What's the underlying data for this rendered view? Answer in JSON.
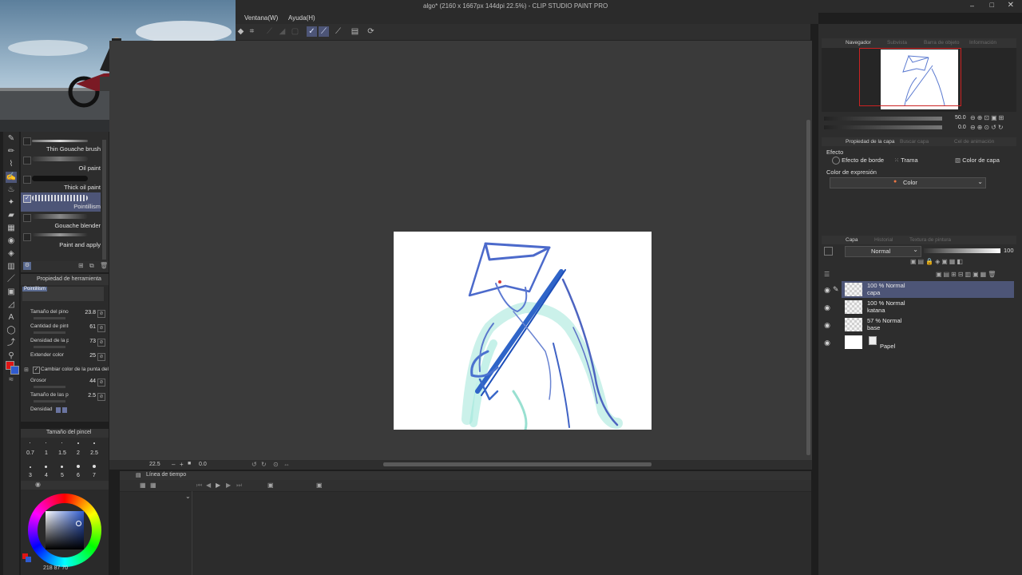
{
  "window": {
    "title": "algo* (2160 x 1667px 144dpi 22.5%) - CLIP STUDIO PAINT PRO"
  },
  "menu": {
    "items": [
      "Ventana(W)",
      "Ayuda(H)"
    ]
  },
  "subtool": {
    "brushes": [
      {
        "name": "Thin Gouache brush",
        "selected": false
      },
      {
        "name": "Oil paint",
        "selected": false
      },
      {
        "name": "Thick oil paint",
        "selected": false
      },
      {
        "name": "Pointillism",
        "selected": true
      },
      {
        "name": "Gouache blender",
        "selected": false
      },
      {
        "name": "Paint and apply",
        "selected": false
      }
    ]
  },
  "tool_property": {
    "title": "Propiedad de herramienta",
    "tool_name": "Pointillism",
    "rows": [
      {
        "label": "Tamaño del pincel",
        "value": "23.8"
      },
      {
        "label": "Cantidad de pintura",
        "value": "61"
      },
      {
        "label": "Densidad de la pintura",
        "value": "73"
      },
      {
        "label": "Extender color",
        "value": "25"
      },
      {
        "label": "Cambiar color de la punta del pincel",
        "value": ""
      },
      {
        "label": "Grosor",
        "value": "44"
      },
      {
        "label": "Tamaño de las partículas",
        "value": "2.5"
      },
      {
        "label": "Densidad",
        "value": ""
      }
    ]
  },
  "brush_size": {
    "title": "Tamaño del pincel",
    "row1": [
      "0.7",
      "1",
      "1.5",
      "2",
      "2.5"
    ],
    "row2": [
      "3",
      "4",
      "5",
      "6",
      "7"
    ]
  },
  "color": {
    "main": "#e01515",
    "sub": "#2f5bd0",
    "readout": "218  87  70"
  },
  "canvas": {
    "zoom": "22.5",
    "rotation": "0.0"
  },
  "timeline": {
    "title": "Línea de tiempo"
  },
  "navigator": {
    "tabs": [
      "Navegador",
      "Subvista",
      "Barra de objeto",
      "Información"
    ],
    "zoom": "50.0",
    "rotation": "0.0"
  },
  "layer_property": {
    "tabs": [
      "Propiedad de la capa",
      "Buscar capa",
      "Cel de animación"
    ],
    "effect_label": "Efecto",
    "effect_buttons": [
      "Efecto de borde",
      "Trama",
      "Color de capa"
    ],
    "expression_label": "Color de expresión",
    "expression_value": "Color"
  },
  "layers_panel": {
    "tabs": [
      "Capa",
      "Historial",
      "Textura de pintura"
    ],
    "blend_mode": "Normal",
    "opacity": "100",
    "layers": [
      {
        "line1": "100 % Normal",
        "line2": "capa",
        "selected": true,
        "paper": false
      },
      {
        "line1": "100 % Normal",
        "line2": "katana",
        "selected": false,
        "paper": false
      },
      {
        "line1": "57 % Normal",
        "line2": "base",
        "selected": false,
        "paper": false
      },
      {
        "line1": "",
        "line2": "Papel",
        "selected": false,
        "paper": true
      }
    ]
  }
}
